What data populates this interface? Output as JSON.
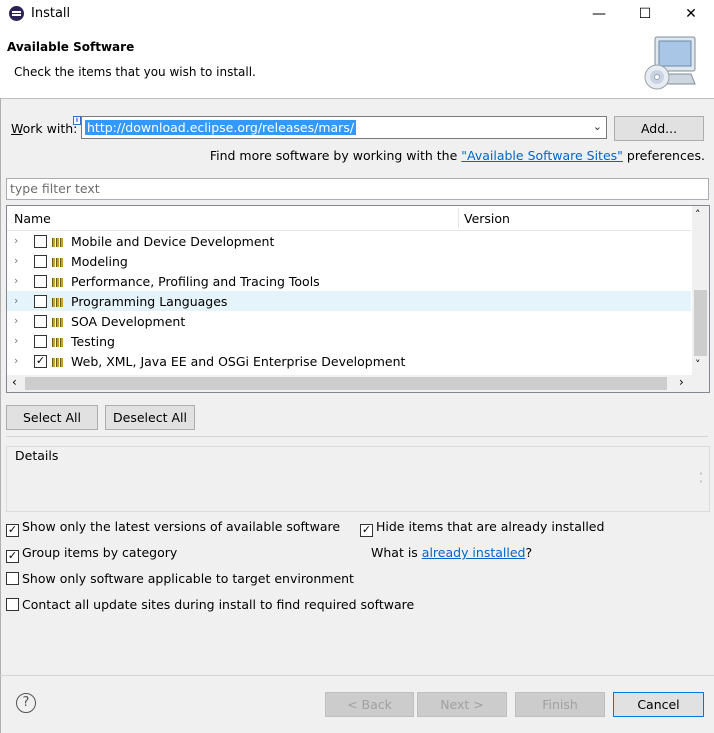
{
  "window": {
    "title": "Install",
    "minimize": "—",
    "maximize": "☐",
    "close": "✕"
  },
  "header": {
    "title": "Available Software",
    "subtitle": "Check the items that you wish to install."
  },
  "work_with": {
    "label": "Work with:",
    "value": "http://download.eclipse.org/releases/mars/",
    "add_button": "Add...",
    "info_mark": "i"
  },
  "find_more": {
    "prefix": "Find more software by working with the ",
    "link": "\"Available Software Sites\"",
    "suffix": " preferences."
  },
  "filter": {
    "placeholder": "type filter text"
  },
  "tree": {
    "columns": [
      "Name",
      "Version"
    ],
    "rows": [
      {
        "name": "Mobile and Device Development",
        "checked": false,
        "highlighted": false
      },
      {
        "name": "Modeling",
        "checked": false,
        "highlighted": false
      },
      {
        "name": "Performance, Profiling and Tracing Tools",
        "checked": false,
        "highlighted": false
      },
      {
        "name": "Programming Languages",
        "checked": false,
        "highlighted": true
      },
      {
        "name": "SOA Development",
        "checked": false,
        "highlighted": false
      },
      {
        "name": "Testing",
        "checked": false,
        "highlighted": false
      },
      {
        "name": "Web, XML, Java EE and OSGi Enterprise Development",
        "checked": true,
        "highlighted": false
      }
    ]
  },
  "buttons": {
    "select_all": "Select All",
    "deselect_all": "Deselect All"
  },
  "details": {
    "title": "Details"
  },
  "options": {
    "latest_versions": {
      "label": "Show only the latest versions of available software",
      "checked": true
    },
    "hide_installed": {
      "label": "Hide items that are already installed",
      "checked": true
    },
    "group_by_category": {
      "label": "Group items by category",
      "checked": true
    },
    "target_env": {
      "label": "Show only software applicable to target environment",
      "checked": false
    },
    "contact_sites": {
      "label": "Contact all update sites during install to find required software",
      "checked": false
    }
  },
  "what_is": {
    "prefix": "What is ",
    "link": "already installed",
    "suffix": "?"
  },
  "nav": {
    "back": "< Back",
    "next": "Next >",
    "finish": "Finish",
    "cancel": "Cancel"
  }
}
